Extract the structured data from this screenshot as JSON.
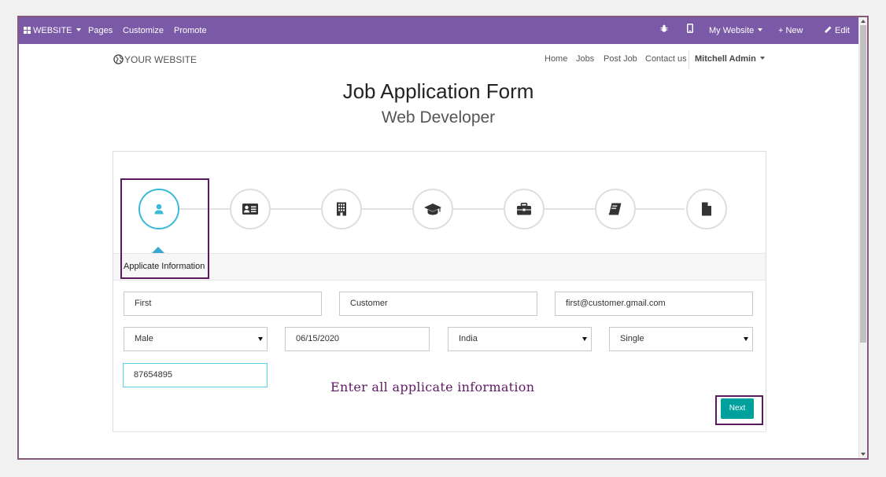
{
  "topbar": {
    "apps_label": "WEBSITE",
    "pages": "Pages",
    "customize": "Customize",
    "promote": "Promote",
    "website_switch": "My Website",
    "new": "+ New",
    "edit": "Edit",
    "bg_color": "#7a59a6"
  },
  "site": {
    "logo_text": "YOUR WEBSITE",
    "nav": [
      "Home",
      "Jobs",
      "Post Job",
      "Contact us"
    ],
    "user": "Mitchell Admin"
  },
  "page": {
    "title": "Job Application Form",
    "subtitle": "Web Developer"
  },
  "wizard": {
    "steps": [
      {
        "icon": "user-icon",
        "active": true
      },
      {
        "icon": "id-card-icon",
        "active": false
      },
      {
        "icon": "building-icon",
        "active": false
      },
      {
        "icon": "graduation-cap-icon",
        "active": false
      },
      {
        "icon": "briefcase-icon",
        "active": false
      },
      {
        "icon": "book-icon",
        "active": false
      },
      {
        "icon": "file-icon",
        "active": false
      }
    ],
    "active_label": "Applicate Information",
    "accent_color": "#3cb8d8"
  },
  "form": {
    "first_name": "First",
    "last_name": "Customer",
    "email": "first@customer.gmail.com",
    "gender": "Male",
    "birth_date": "06/15/2020",
    "country": "India",
    "marital_status": "Single",
    "phone": "87654895"
  },
  "annotation": "Enter all applicate information",
  "next_button": {
    "label": "Next",
    "color": "#00a09d"
  }
}
